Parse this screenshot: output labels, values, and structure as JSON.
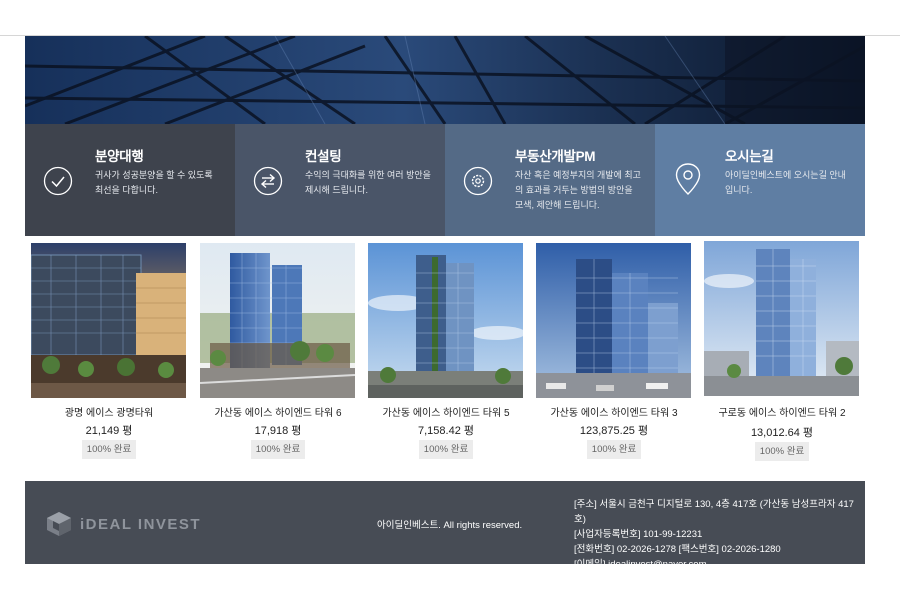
{
  "services": [
    {
      "title": "분양대행",
      "desc": "귀사가 성공분양을 할 수 있도록 최선을 다합니다.",
      "icon": "check-circle-icon",
      "bg": "#3e434d"
    },
    {
      "title": "컨설팅",
      "desc": "수익의 극대화를 위한 여러 방안을 제시해 드립니다.",
      "icon": "exchange-arrows-icon",
      "bg": "#4a5568"
    },
    {
      "title": "부동산개발PM",
      "desc": "자산 혹은 예정부지의 개발에 최고의 효과를 거두는 방법의 방안을 모색, 제안해 드립니다.",
      "icon": "gear-circle-icon",
      "bg": "#546a86"
    },
    {
      "title": "오시는길",
      "desc": "아이딜인베스트에 오시는길 안내입니다.",
      "icon": "map-pin-icon",
      "bg": "#5f7ea3"
    }
  ],
  "projects": [
    {
      "name": "광명 에이스 광명타워",
      "size": "21,149 평",
      "status": "100% 완료"
    },
    {
      "name": "가산동 에이스 하이엔드 타워 6",
      "size": "17,918 평",
      "status": "100% 완료"
    },
    {
      "name": "가산동 에이스 하이엔드 타워 5",
      "size": "7,158.42 평",
      "status": "100% 완료"
    },
    {
      "name": "가산동 에이스 하이엔드 타워 3",
      "size": "123,875.25 평",
      "status": "100% 완료"
    },
    {
      "name": "구로동 에이스 하이엔드 타워 2",
      "size": "13,012.64 평",
      "status": "100% 완료"
    }
  ],
  "footer": {
    "logo_text": "iDEAL INVEST",
    "copyright": "아이딜인베스트. All rights reserved.",
    "info_lines": [
      "[주소] 서울시 금천구 디지털로 130, 4층 417호 (가산동 남성프라자 417호)",
      "[사업자등록번호] 101-99-12231",
      "[전화번호] 02-2026-1278 [팩스번호] 02-2026-1280",
      "[이메일] idealinvest@naver.com"
    ],
    "bg": "#474c55"
  }
}
